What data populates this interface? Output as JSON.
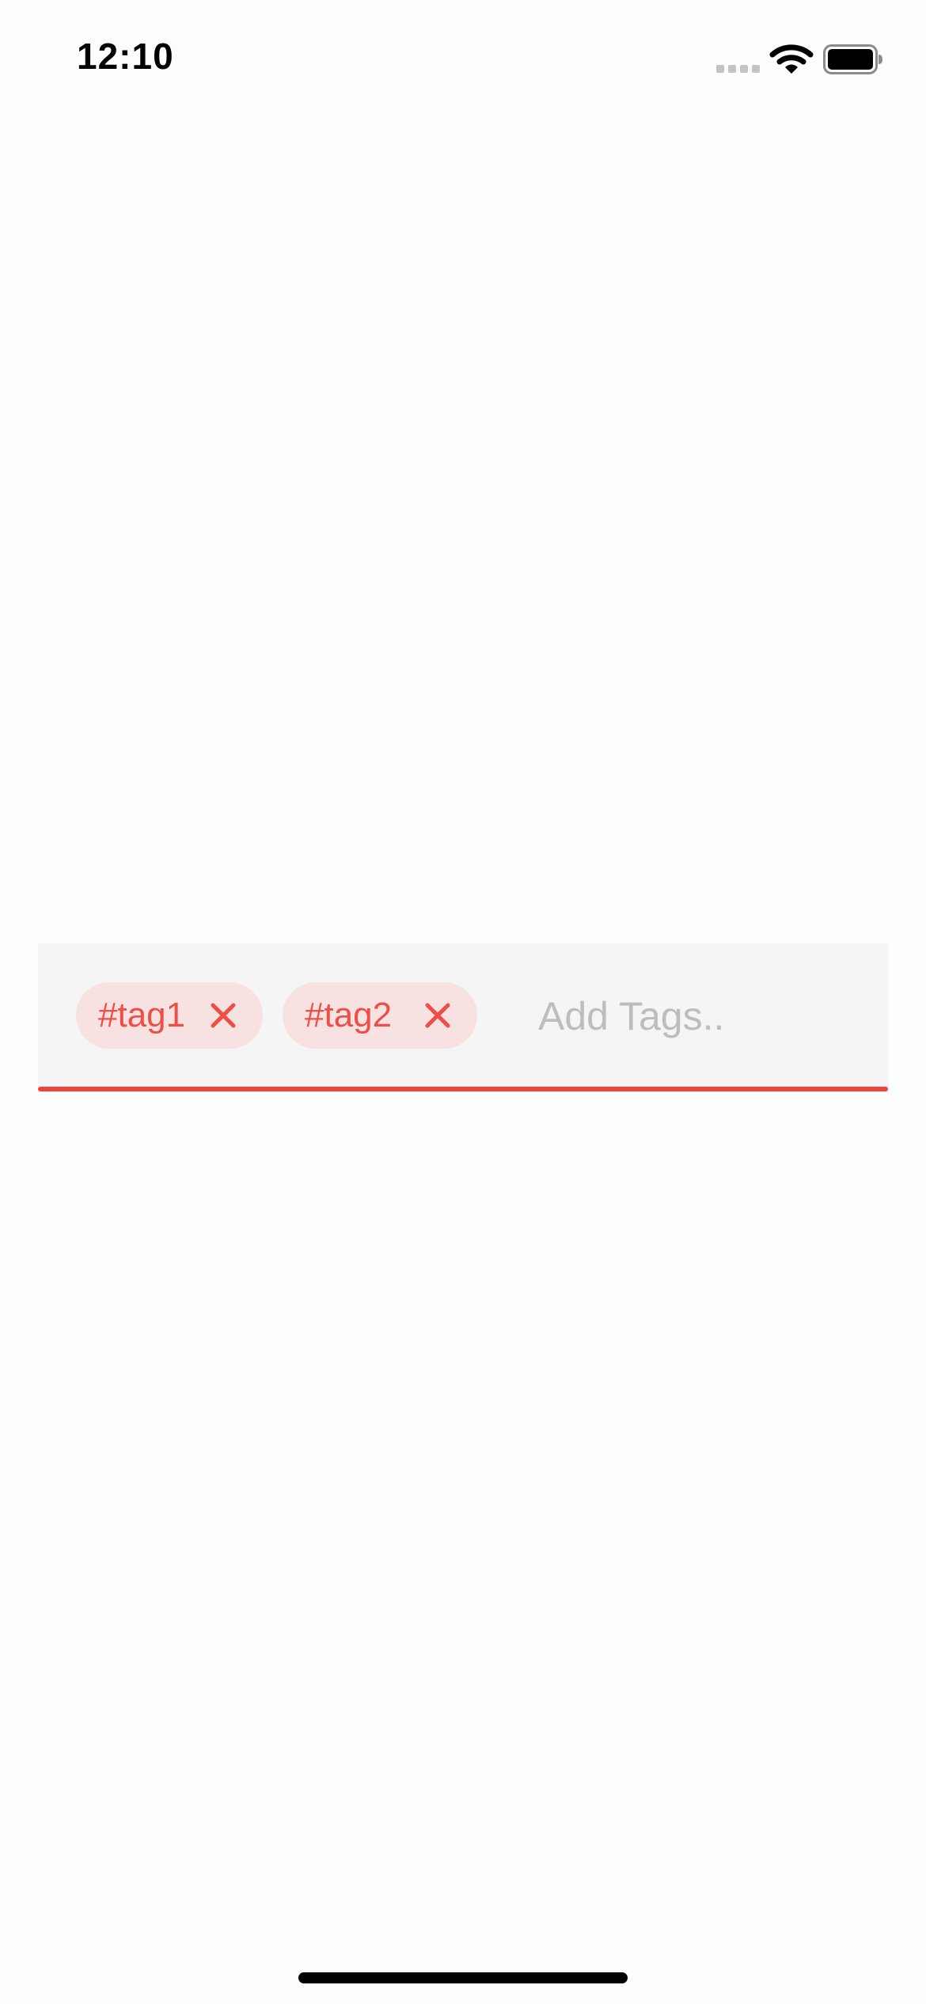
{
  "status_bar": {
    "time": "12:10",
    "signal_icon": "cellular-signal-icon",
    "wifi_icon": "wifi-icon",
    "battery_icon": "battery-full-icon"
  },
  "tag_input": {
    "tags": [
      {
        "label": "#tag1",
        "remove_icon": "close-icon"
      },
      {
        "label": "#tag2",
        "remove_icon": "close-icon"
      }
    ],
    "value": "",
    "placeholder": "Add Tags..",
    "colors": {
      "accent": "#f0423a",
      "chip_background": "#f7e2e1",
      "chip_text": "#ee4e46",
      "field_background": "#f5f5f5",
      "placeholder": "#bdbdbd"
    }
  }
}
